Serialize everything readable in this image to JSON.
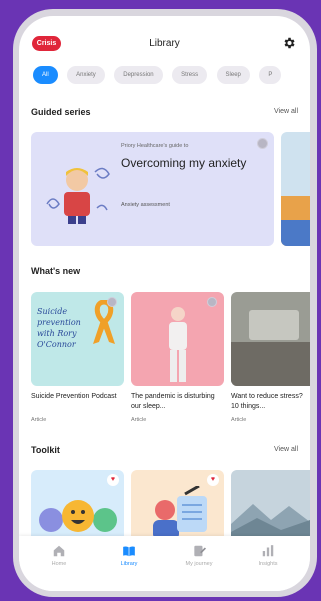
{
  "header": {
    "crisis_label": "Crisis",
    "title": "Library",
    "settings_icon": "gear-icon"
  },
  "filters": [
    "All",
    "Anxiety",
    "Depression",
    "Stress",
    "Sleep",
    "P"
  ],
  "guided": {
    "heading": "Guided series",
    "view_all": "View all",
    "card": {
      "eyebrow": "Priory Healthcare's guide to",
      "title": "Overcoming my anxiety",
      "subtitle": "Anxiety assessment"
    }
  },
  "whats_new": {
    "heading": "What's new",
    "items": [
      {
        "title": "Suicide Prevention Podcast",
        "type": "Article",
        "art_text": "Suicide prevention with Rory O'Connor"
      },
      {
        "title": "The pandemic is disturbing our sleep...",
        "type": "Article"
      },
      {
        "title": "Want to reduce stress? 10 things...",
        "type": "Article"
      }
    ]
  },
  "toolkit": {
    "heading": "Toolkit",
    "view_all": "View all"
  },
  "nav": [
    {
      "label": "Home",
      "icon": "home-icon"
    },
    {
      "label": "Library",
      "icon": "book-icon"
    },
    {
      "label": "My journey",
      "icon": "journal-icon"
    },
    {
      "label": "Insights",
      "icon": "bar-chart-icon"
    }
  ],
  "colors": {
    "accent": "#1a8cff",
    "crisis": "#e0263a",
    "frame": "#6a34b4"
  }
}
